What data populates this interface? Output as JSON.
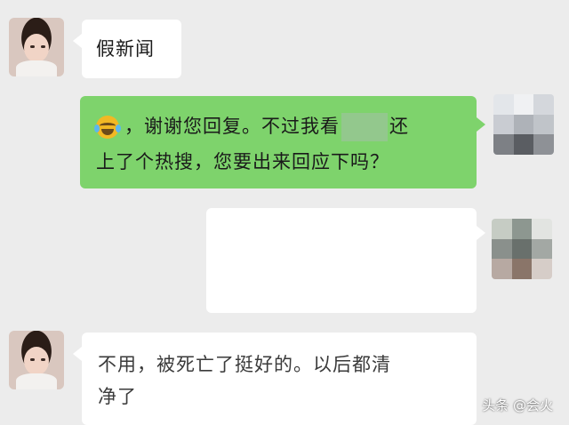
{
  "messages": {
    "m1_text": "假新闻",
    "m2_before": "，谢谢您回复。不过我看",
    "m2_after": "还",
    "m2_line2": "上了个热搜，您要出来回应下吗？",
    "m4_line1": "不用，被死亡了挺好的。以后都清",
    "m4_line2": "净了"
  },
  "watermark": "头条 @会火",
  "colors": {
    "background": "#ececec",
    "green_bubble": "#7ed36c",
    "white_bubble": "#ffffff"
  },
  "icons": {
    "emoji": "crying-laughing-emoji-icon"
  }
}
